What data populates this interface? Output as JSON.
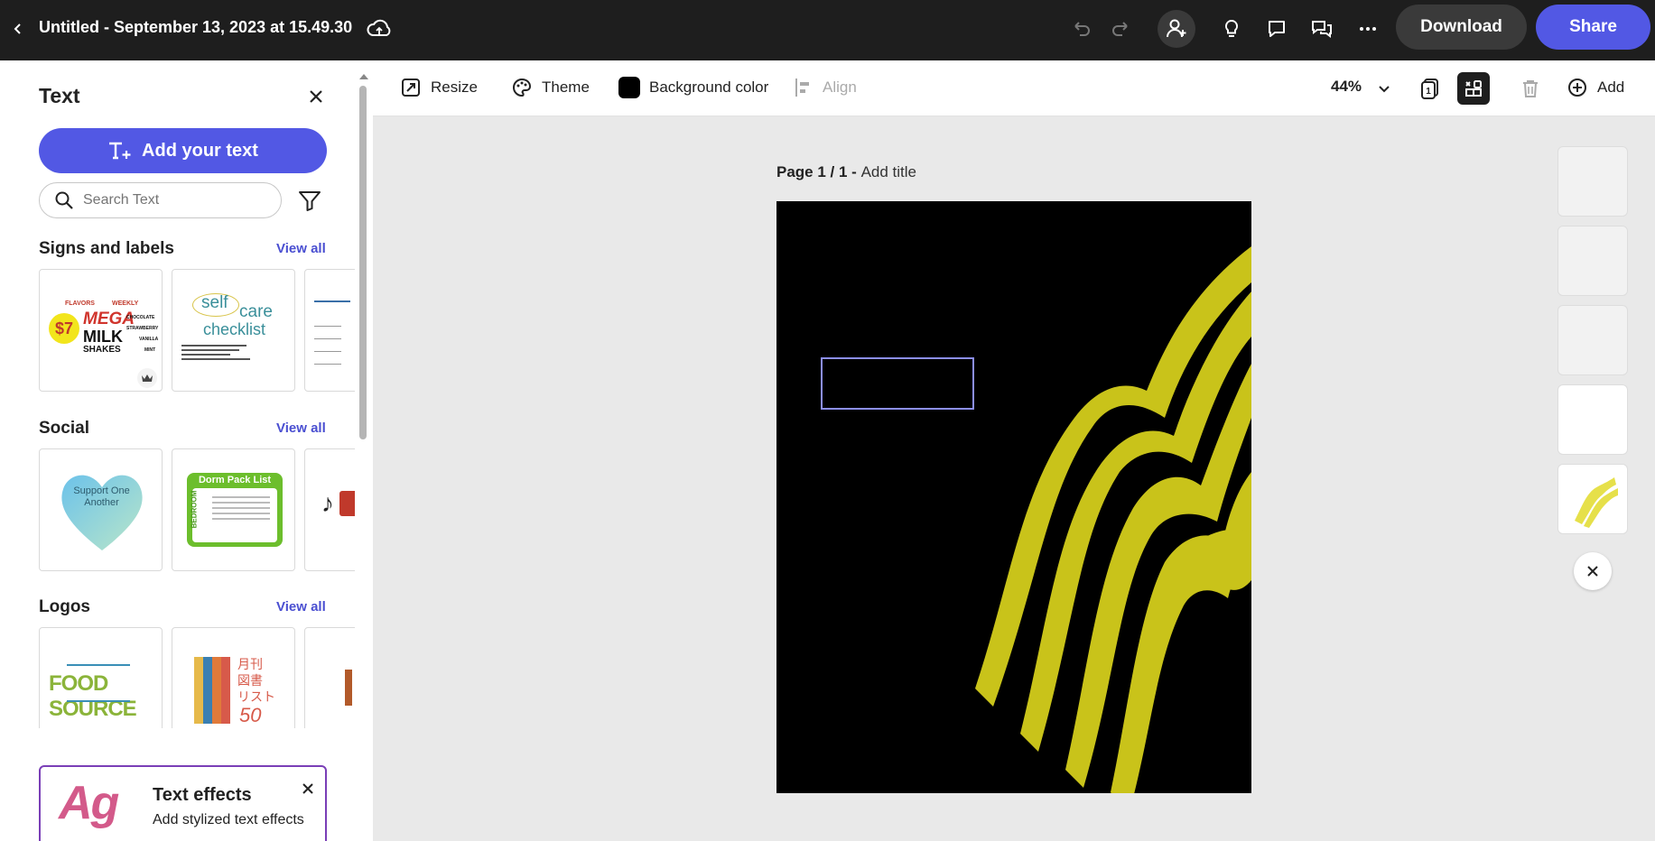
{
  "header": {
    "title": "Untitled - September 13, 2023 at 15.49.30",
    "download_label": "Download",
    "share_label": "Share"
  },
  "panel": {
    "title": "Text",
    "add_text_label": "Add your text",
    "search_placeholder": "Search Text",
    "view_all": "View all",
    "sections": [
      {
        "title": "Signs and labels",
        "thumbs": [
          {
            "lines": [
              "FLAVORS",
              "WEEKLY",
              "$7",
              "MEGA",
              "MILK",
              "SHAKES",
              "CHOCOLATE",
              "STRAWBERRY",
              "VANILLA",
              "MINT"
            ]
          },
          {
            "lines": [
              "self",
              "care",
              "checklist"
            ]
          },
          {
            "lines": []
          }
        ]
      },
      {
        "title": "Social",
        "thumbs": [
          {
            "lines": [
              "Support One",
              "Another"
            ]
          },
          {
            "lines": [
              "Dorm Pack List",
              "BEDROOM"
            ]
          },
          {
            "lines": []
          }
        ]
      },
      {
        "title": "Logos",
        "thumbs": [
          {
            "lines": [
              "FOOD SOURCE"
            ]
          },
          {
            "lines": [
              "月刊",
              "図書",
              "リスト",
              "50"
            ]
          },
          {
            "lines": []
          }
        ]
      }
    ],
    "effects": {
      "glyph": "Ag",
      "title": "Text effects",
      "subtitle": "Add stylized text effects"
    }
  },
  "toolbar": {
    "resize": "Resize",
    "theme": "Theme",
    "background_color": "Background color",
    "align": "Align",
    "zoom": "44%",
    "add": "Add"
  },
  "canvas": {
    "page_label": "Page 1 / 1 -",
    "add_title": "Add title"
  },
  "colors": {
    "accent": "#5258e4",
    "topbar": "#1e1e1e",
    "artwork_yellow": "#c9c31a"
  }
}
